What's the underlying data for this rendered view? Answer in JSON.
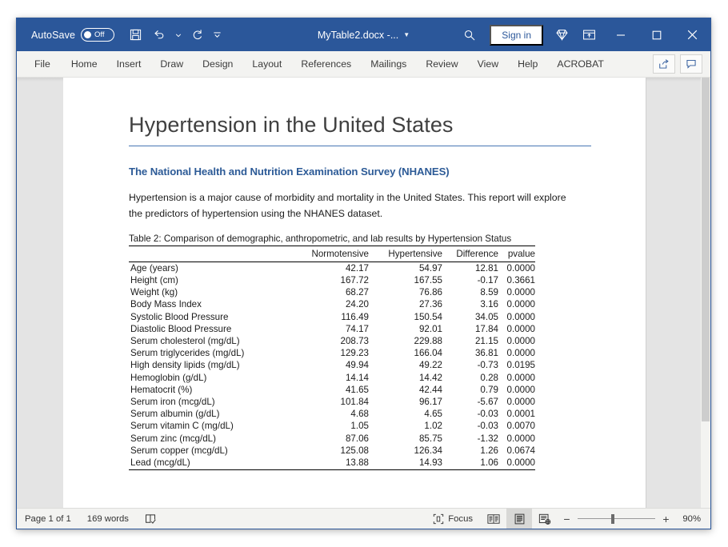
{
  "titlebar": {
    "autosave_label": "AutoSave",
    "autosave_state": "Off",
    "doc_title": "MyTable2.docx  -...",
    "signin_label": "Sign in",
    "accent_color": "#2b579a",
    "icons": {
      "save": "save-icon",
      "undo": "undo-icon",
      "redo": "redo-icon",
      "customize": "customize-quick-access-icon",
      "search": "search-icon",
      "premium": "diamond-icon",
      "ribbon_display": "ribbon-display-options-icon",
      "minimize": "minimize-icon",
      "maximize": "maximize-icon",
      "close": "close-icon"
    }
  },
  "ribbon": {
    "tabs": [
      {
        "label": "File"
      },
      {
        "label": "Home"
      },
      {
        "label": "Insert"
      },
      {
        "label": "Draw"
      },
      {
        "label": "Design"
      },
      {
        "label": "Layout"
      },
      {
        "label": "References"
      },
      {
        "label": "Mailings"
      },
      {
        "label": "Review"
      },
      {
        "label": "View"
      },
      {
        "label": "Help"
      },
      {
        "label": "ACROBAT"
      }
    ],
    "share_label": "share-icon",
    "comments_label": "comments-icon"
  },
  "document": {
    "title": "Hypertension in the United States",
    "heading2": "The National Health and Nutrition Examination Survey (NHANES)",
    "paragraph": "Hypertension is a major cause of morbidity and mortality in the United States.  This report will explore the predictors of hypertension using the NHANES dataset.",
    "table": {
      "caption": "Table 2: Comparison of demographic, anthropometric, and lab results by Hypertension Status",
      "columns": [
        "",
        "Normotensive",
        "Hypertensive",
        "Difference",
        "pvalue"
      ],
      "rows": [
        [
          "Age (years)",
          "42.17",
          "54.97",
          "12.81",
          "0.0000"
        ],
        [
          "Height (cm)",
          "167.72",
          "167.55",
          "-0.17",
          "0.3661"
        ],
        [
          "Weight (kg)",
          "68.27",
          "76.86",
          "8.59",
          "0.0000"
        ],
        [
          "Body Mass Index",
          "24.20",
          "27.36",
          "3.16",
          "0.0000"
        ],
        [
          "Systolic Blood Pressure",
          "116.49",
          "150.54",
          "34.05",
          "0.0000"
        ],
        [
          "Diastolic Blood Pressure",
          "74.17",
          "92.01",
          "17.84",
          "0.0000"
        ],
        [
          "Serum cholesterol (mg/dL)",
          "208.73",
          "229.88",
          "21.15",
          "0.0000"
        ],
        [
          "Serum triglycerides (mg/dL)",
          "129.23",
          "166.04",
          "36.81",
          "0.0000"
        ],
        [
          "High density lipids (mg/dL)",
          "49.94",
          "49.22",
          "-0.73",
          "0.0195"
        ],
        [
          "Hemoglobin (g/dL)",
          "14.14",
          "14.42",
          "0.28",
          "0.0000"
        ],
        [
          "Hematocrit (%)",
          "41.65",
          "42.44",
          "0.79",
          "0.0000"
        ],
        [
          "Serum iron (mcg/dL)",
          "101.84",
          "96.17",
          "-5.67",
          "0.0000"
        ],
        [
          "Serum albumin (g/dL)",
          "4.68",
          "4.65",
          "-0.03",
          "0.0001"
        ],
        [
          "Serum vitamin C (mg/dL)",
          "1.05",
          "1.02",
          "-0.03",
          "0.0070"
        ],
        [
          "Serum zinc (mcg/dL)",
          "87.06",
          "85.75",
          "-1.32",
          "0.0000"
        ],
        [
          "Serum copper (mcg/dL)",
          "125.08",
          "126.34",
          "1.26",
          "0.0674"
        ],
        [
          "Lead (mcg/dL)",
          "13.88",
          "14.93",
          "1.06",
          "0.0000"
        ]
      ]
    }
  },
  "statusbar": {
    "page_info": "Page 1 of 1",
    "word_count": "169 words",
    "proofing_icon": "proofing-errors-icon",
    "focus_label": "Focus",
    "focus_icon": "focus-mode-icon",
    "view_read_icon": "read-mode-icon",
    "view_print_icon": "print-layout-icon",
    "view_web_icon": "web-layout-icon",
    "zoom_out": "−",
    "zoom_in": "+",
    "zoom_level": "90%"
  }
}
